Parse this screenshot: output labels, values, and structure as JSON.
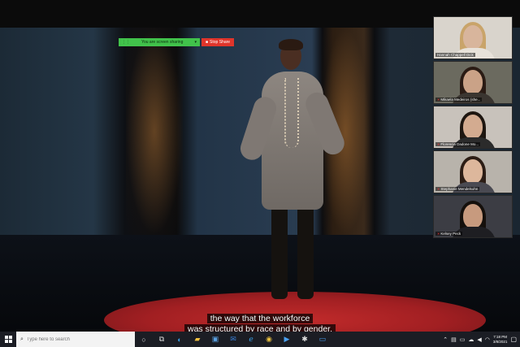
{
  "share_bar": {
    "status": "You are screen sharing",
    "stop_label": "Stop Share",
    "accent_green": "#41c24b",
    "accent_red": "#e0352b"
  },
  "captions": {
    "line1": "the way that the workforce",
    "line2": "was structured by race and by gender."
  },
  "participants": [
    {
      "name": "Hannah Chappell Dick",
      "muted": false
    },
    {
      "name": "Mikaela Medeiros (she...",
      "muted": true
    },
    {
      "name": "Florencia Dadone Mo...",
      "muted": true
    },
    {
      "name": "Stephanie Mendelsohn",
      "muted": true
    },
    {
      "name": "Kelsey Peck",
      "muted": true
    }
  ],
  "taskbar": {
    "search_placeholder": "Type here to search",
    "pinned_icons": [
      "task-view-icon",
      "edge-icon",
      "file-explorer-icon",
      "store-icon",
      "mail-icon",
      "edge-legacy-icon",
      "chrome-icon",
      "zoom-icon",
      "slack-icon",
      "zoom-meeting-icon"
    ],
    "time": "7:18 PM",
    "date": "3/8/2021"
  }
}
